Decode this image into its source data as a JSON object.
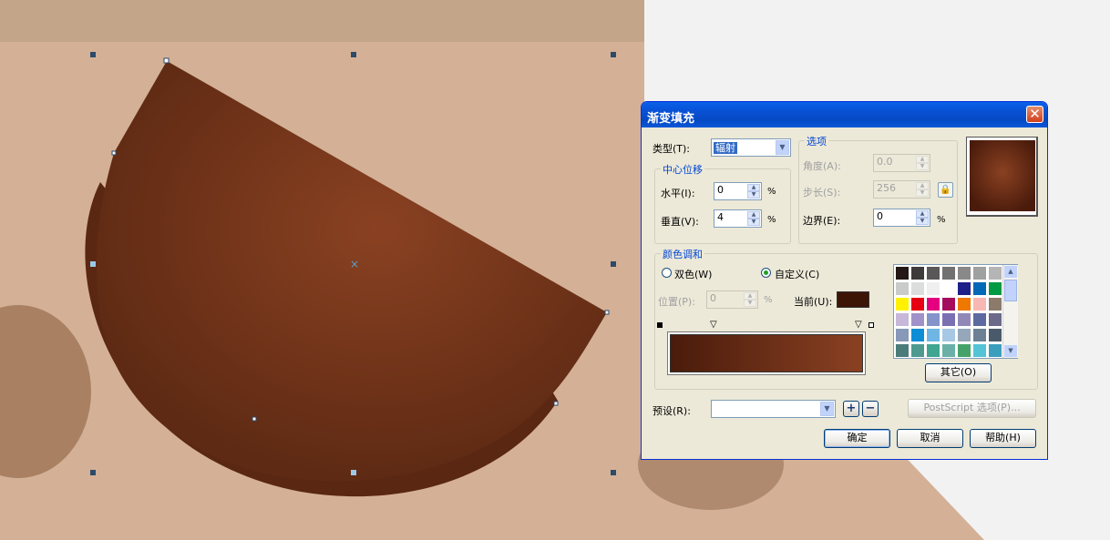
{
  "colors": {
    "bg_top": "#c3a589",
    "bg_main": "#d4b196",
    "bg_right": "#f2f2f3",
    "fill_center": "#8a4122",
    "fill_edge": "#5a2712",
    "selection_handle": "#2d4a6b"
  },
  "dialog": {
    "title": "渐变填充",
    "close_glyph": "✕",
    "type_label": "类型(T):",
    "type_value": "辐射",
    "center_offset_title": "中心位移",
    "horizontal_label": "水平(I):",
    "horizontal_value": "0",
    "vertical_label": "垂直(V):",
    "vertical_value": "4",
    "percent": "%",
    "options_title": "选项",
    "angle_label": "角度(A):",
    "angle_value": "0.0",
    "steps_label": "步长(S):",
    "steps_value": "256",
    "edge_label": "边界(E):",
    "edge_value": "0",
    "color_blend_title": "颜色调和",
    "two_color_label": "双色(W)",
    "custom_label": "自定义(C)",
    "position_label": "位置(P):",
    "position_value": "0",
    "current_label": "当前(U):",
    "current_color": "#3d1507",
    "others_button": "其它(O)",
    "preset_label": "预设(R):",
    "preset_value": "",
    "postscript_button": "PostScript 选项(P)...",
    "ok_button": "确定",
    "cancel_button": "取消",
    "help_button": "帮助(H)",
    "gradient_start": "#4a1b0b",
    "gradient_end": "#8a4122",
    "palette": [
      "#231815",
      "#3e3a39",
      "#595757",
      "#727171",
      "#898989",
      "#9fa0a0",
      "#b5b5b6",
      "#c9caca",
      "#dcdddd",
      "#efefef",
      "#ffffff",
      "#1d2088",
      "#0068b7",
      "#009944",
      "#fff100",
      "#e60012",
      "#e4007f",
      "#a40b5d",
      "#ee7800",
      "#f8b7b2",
      "#8c7a6b",
      "#c7b7d8",
      "#a091c8",
      "#8493ca",
      "#7b6fb3",
      "#9288b8",
      "#5c6aa0",
      "#6c6a8a",
      "#8798b8",
      "#0d8dd5",
      "#6fb6e5",
      "#a7c7e4",
      "#95a7b8",
      "#6c8294",
      "#4a5a6a",
      "#4b7c7a",
      "#4f9a8f",
      "#40a591",
      "#6ab0a6",
      "#45a36a",
      "#54c3d6",
      "#3c9ebd"
    ]
  }
}
